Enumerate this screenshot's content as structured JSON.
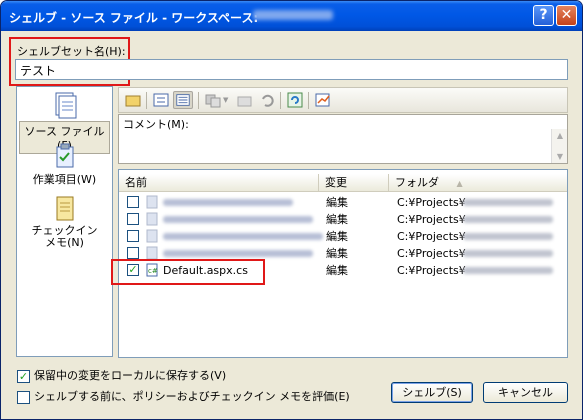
{
  "window": {
    "title": "シェルブ - ソース ファイル - ワークスペース:",
    "help_glyph": "?",
    "close_glyph": "✕"
  },
  "shelveset": {
    "label": "シェルブセット名(H):",
    "value": "テスト"
  },
  "left_nav": [
    {
      "label": "ソース ファイル(F)",
      "icon": "source-files-icon",
      "selected": true
    },
    {
      "label": "作業項目(W)",
      "icon": "work-items-icon",
      "selected": false
    },
    {
      "label": "チェックイン\nメモ(N)",
      "icon": "checkin-notes-icon",
      "selected": false
    }
  ],
  "toolbar_icons": [
    "folder-icon",
    "list-view-icon",
    "details-view-icon",
    "workspace-icon",
    "open-folder-icon",
    "undo-icon",
    "refresh-icon",
    "compare-icon"
  ],
  "comment": {
    "label": "コメント(M):",
    "value": ""
  },
  "file_list": {
    "columns": [
      "名前",
      "変更",
      "フォルダ"
    ],
    "sort_indicator": "▲",
    "rows": [
      {
        "name": "",
        "checked": false,
        "change": "編集",
        "folder": "C:¥Projects¥"
      },
      {
        "name": "",
        "checked": false,
        "change": "編集",
        "folder": "C:¥Projects¥"
      },
      {
        "name": "",
        "checked": false,
        "change": "編集",
        "folder": "C:¥Projects¥"
      },
      {
        "name": "",
        "checked": false,
        "change": "編集",
        "folder": "C:¥Projects¥"
      },
      {
        "name": "Default.aspx.cs",
        "checked": true,
        "change": "編集",
        "folder": "C:¥Projects¥"
      }
    ]
  },
  "options": {
    "preserve_local": {
      "label": "保留中の変更をローカルに保存する(V)",
      "checked": true
    },
    "evaluate_policy": {
      "label": "シェルブする前に、ポリシーおよびチェックイン メモを評価(E)",
      "checked": false
    }
  },
  "buttons": {
    "shelve": "シェルブ(S)",
    "cancel": "キャンセル"
  },
  "colors": {
    "title_bar": "#0058e6",
    "highlight_box": "#e01818",
    "dialog_bg": "#ece9d8"
  }
}
